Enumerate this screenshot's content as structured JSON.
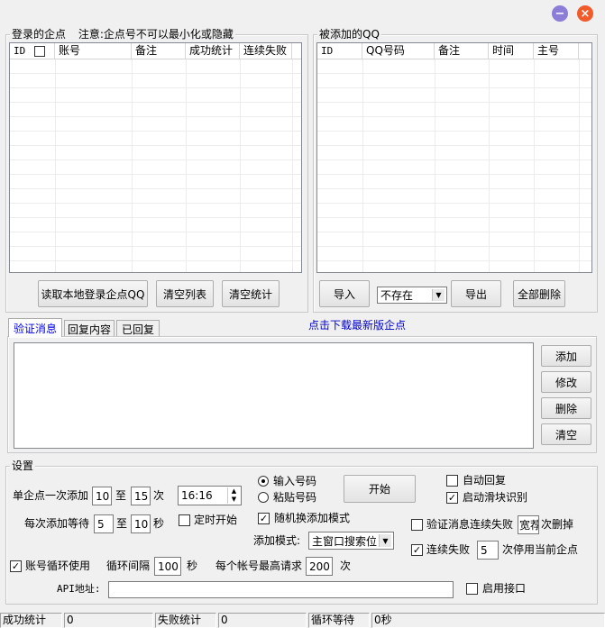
{
  "window": {
    "minimize_glyph": "−",
    "close_glyph": "×",
    "minimize_color": "#8b7dd8",
    "close_color": "#f15a2b"
  },
  "login_group": {
    "title": "登录的企点",
    "notice": "注意:企点号不可以最小化或隐藏",
    "columns": [
      "ID",
      "账号",
      "备注",
      "成功统计",
      "连续失败"
    ],
    "buttons": {
      "read_local": "读取本地登录企点QQ",
      "clear_list": "清空列表",
      "clear_stats": "清空统计"
    }
  },
  "added_group": {
    "title": "被添加的QQ",
    "columns": [
      "ID",
      "QQ号码",
      "备注",
      "时间",
      "主号"
    ],
    "buttons": {
      "import": "导入",
      "export": "导出",
      "delete_all": "全部删除"
    },
    "filter_value": "不存在"
  },
  "download_link": "点击下载最新版企点",
  "tabs": [
    {
      "label": "验证消息"
    },
    {
      "label": "回复内容"
    },
    {
      "label": "已回复"
    }
  ],
  "message_buttons": {
    "add": "添加",
    "modify": "修改",
    "delete": "删除",
    "clear": "清空"
  },
  "settings": {
    "title": "设置",
    "per_account_add_label": "单企点一次添加",
    "per_add_min": "10",
    "to_label": "至",
    "per_add_max": "15",
    "times_label": "次",
    "wait_label": "每次添加等待",
    "wait_min": "5",
    "wait_max": "10",
    "seconds_label": "秒",
    "time_value": "16:16",
    "timed_start_label": "定时开始",
    "input_number_label": "输入号码",
    "paste_number_label": "粘贴号码",
    "start_button": "开始",
    "random_mode_label": "随机换添加模式",
    "add_mode_label": "添加模式:",
    "add_mode_value": "主窗口搜索位",
    "auto_reply_label": "自动回复",
    "slider_recognition_label": "启动滑块识别",
    "verify_fail_label": "验证消息连续失败",
    "verify_fail_value": "宽荐",
    "delete_times_label": "次删掉",
    "consecutive_fail_label": "连续失败",
    "consecutive_fail_value": "5",
    "stop_label": "次停用当前企点",
    "account_loop_label": "账号循环使用",
    "loop_interval_label": "循环间隔",
    "loop_interval_value": "100",
    "loop_seconds_label": "秒",
    "max_request_label": "每个帐号最高请求",
    "max_request_value": "200",
    "max_request_unit": "次",
    "api_label": "API地址:",
    "api_value": "",
    "enable_api_label": "启用接口"
  },
  "status_bar": {
    "success_label": "成功统计",
    "success_value": "0",
    "fail_label": "失败统计",
    "fail_value": "0",
    "loop_wait_label": "循环等待",
    "loop_wait_value": "0秒"
  }
}
